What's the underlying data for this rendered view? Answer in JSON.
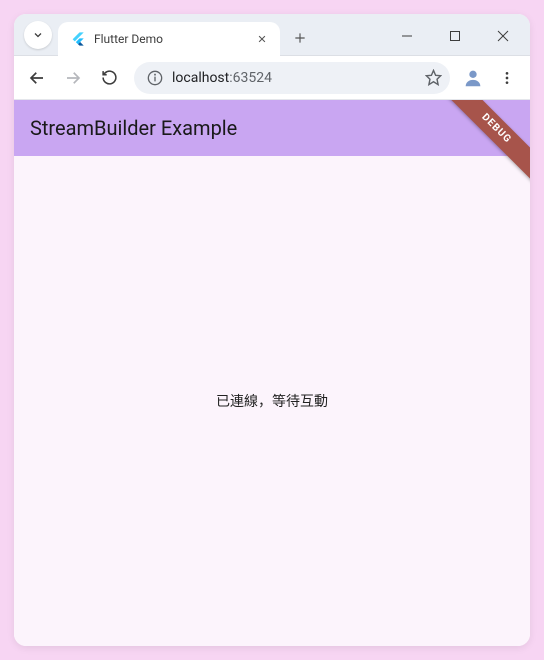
{
  "tab": {
    "title": "Flutter Demo"
  },
  "address": {
    "host": "localhost",
    "port": ":63524"
  },
  "app": {
    "appbar_title": "StreamBuilder Example",
    "status_text": "已連線，等待互動",
    "debug_label": "DEBUG"
  },
  "colors": {
    "appbar": "#c9a6f2",
    "body_bg": "#fcf4fc",
    "debug": "#a7544b"
  }
}
